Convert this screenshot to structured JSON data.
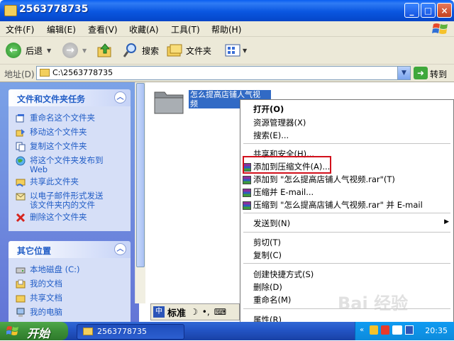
{
  "window": {
    "title": "2563778735"
  },
  "menu": [
    {
      "label": "文件(F)"
    },
    {
      "label": "编辑(E)"
    },
    {
      "label": "查看(V)"
    },
    {
      "label": "收藏(A)"
    },
    {
      "label": "工具(T)"
    },
    {
      "label": "帮助(H)"
    }
  ],
  "toolbar": {
    "back_label": "后退",
    "search_label": "搜索",
    "folders_label": "文件夹"
  },
  "address": {
    "label": "地址(D)",
    "value": "C:\\2563778735",
    "go_label": "转到"
  },
  "tasks_panel": {
    "title": "文件和文件夹任务",
    "items": [
      {
        "label": "重命名这个文件夹",
        "icon": "rename-icon"
      },
      {
        "label": "移动这个文件夹",
        "icon": "move-icon"
      },
      {
        "label": "复制这个文件夹",
        "icon": "copy-icon"
      },
      {
        "label": "将这个文件夹发布到",
        "label2": "Web",
        "icon": "publish-web-icon"
      },
      {
        "label": "共享此文件夹",
        "icon": "share-icon"
      },
      {
        "label": "以电子邮件形式发送",
        "label2": "该文件夹内的文件",
        "icon": "email-icon"
      },
      {
        "label": "删除这个文件夹",
        "icon": "delete-icon"
      }
    ]
  },
  "places_panel": {
    "title": "其它位置",
    "items": [
      {
        "label": "本地磁盘 (C:)",
        "icon": "local-disk-icon"
      },
      {
        "label": "我的文档",
        "icon": "my-documents-icon"
      },
      {
        "label": "共享文档",
        "icon": "shared-documents-icon"
      },
      {
        "label": "我的电脑",
        "icon": "my-computer-icon"
      }
    ]
  },
  "folder": {
    "name_line1": "怎么提高店铺人气视",
    "name_line2": "频"
  },
  "ime": {
    "mode_label": "标准"
  },
  "context_menu": {
    "items": [
      {
        "label": "打开(O)",
        "bold": true
      },
      {
        "label": "资源管理器(X)"
      },
      {
        "label": "搜索(E)..."
      },
      {
        "label": "共享和安全(H)..."
      },
      {
        "label": "添加到压缩文件(A)..."
      },
      {
        "label": "添加到 \"怎么提高店铺人气视频.rar\"(T)"
      },
      {
        "label": "压缩并 E-mail..."
      },
      {
        "label": "压缩到 \"怎么提高店铺人气视频.rar\" 并 E-mail"
      },
      {
        "label": "发送到(N)"
      },
      {
        "label": "剪切(T)"
      },
      {
        "label": "复制(C)"
      },
      {
        "label": "创建快捷方式(S)"
      },
      {
        "label": "删除(D)"
      },
      {
        "label": "重命名(M)"
      },
      {
        "label": "属性(R)"
      }
    ]
  },
  "taskbar": {
    "start_label": "开始",
    "window_label": "2563778735",
    "clock": "20:35"
  },
  "watermark": {
    "text": "Bai 经验"
  },
  "colors": {
    "title_blue": "#0a56e0",
    "highlight_red": "#d2101b",
    "selection_blue": "#316ac5",
    "start_green": "#3b8e37"
  }
}
